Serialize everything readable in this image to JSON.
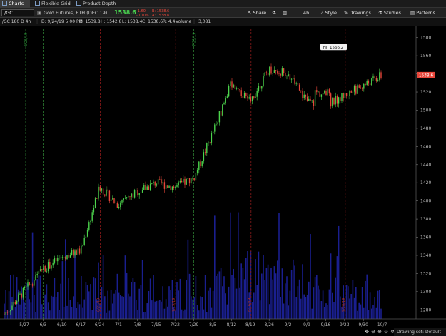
{
  "tabs": [
    {
      "label": "Charts",
      "active": true,
      "icon": "chart-icon"
    },
    {
      "label": "Flexible Grid",
      "active": false,
      "icon": "grid-icon"
    },
    {
      "label": "Product Depth",
      "active": false,
      "icon": "depth-icon"
    }
  ],
  "toolbar": {
    "symbol": "/GC",
    "description": "Gold Futures, ETH (DEC 19)",
    "last": "1538.6",
    "change": "-1.60",
    "change_pct": "-0.10%",
    "bid": "B: 1538.6",
    "ask": "A: 1538.8",
    "buttons": [
      "Share",
      "4h",
      "Style",
      "Drawings",
      "Studies",
      "Patterns"
    ]
  },
  "info": {
    "study_label": "/GC 180 D 4h",
    "date": "D: 9/24/19 5:00 PM",
    "open": "O: 1539.8",
    "high": "H: 1542.8",
    "low": "L: 1538.4",
    "close": "C: 1538.6",
    "range": "R: 4.4",
    "volume_label": "Volume",
    "volume": "3,081"
  },
  "chart_data": {
    "type": "candlestick",
    "x_ticks": [
      "5/27",
      "6/3",
      "6/10",
      "6/17",
      "6/24",
      "7/1",
      "7/8",
      "7/15",
      "7/22",
      "7/29",
      "8/5",
      "8/12",
      "8/19",
      "8/26",
      "9/2",
      "9/9",
      "9/16",
      "9/23",
      "9/30",
      "10/7"
    ],
    "y_ticks": [
      1280,
      1300,
      1320,
      1340,
      1360,
      1380,
      1400,
      1420,
      1440,
      1460,
      1480,
      1500,
      1520,
      1540,
      1560,
      1580
    ],
    "ylim": [
      1270,
      1590
    ],
    "close_path": [
      [
        "5/27",
        1275
      ],
      [
        "6/3",
        1325
      ],
      [
        "6/10",
        1338
      ],
      [
        "6/17",
        1345
      ],
      [
        "6/24",
        1415
      ],
      [
        "7/1",
        1395
      ],
      [
        "7/8",
        1410
      ],
      [
        "7/15",
        1420
      ],
      [
        "7/22",
        1415
      ],
      [
        "7/29",
        1425
      ],
      [
        "8/5",
        1475
      ],
      [
        "8/12",
        1530
      ],
      [
        "8/19",
        1510
      ],
      [
        "8/26",
        1545
      ],
      [
        "9/2",
        1540
      ],
      [
        "9/9",
        1510
      ],
      [
        "9/16",
        1505
      ],
      [
        "9/23",
        1538.6
      ]
    ],
    "hi_label": "Hi: 1566.2",
    "last_price_label": "1538.6",
    "green_markers": [
      "5/27",
      "6/3",
      "7/29"
    ],
    "green_marker_labels": [
      "5/28/19",
      "",
      "7/29/19"
    ],
    "red_markers": [
      "6/24",
      "7/22",
      "8/19",
      "9/23"
    ],
    "red_marker_labels": [
      "6/21/19",
      "7/19/19",
      "8/16/19",
      "9/20/19"
    ],
    "colors": {
      "up": "#4cd44c",
      "down": "#e8463a",
      "volume": "#1a1f8f",
      "marker_green": "#2e7d32",
      "marker_red": "#8b1a1a"
    }
  },
  "footer": {
    "drawing_set": "Drawing set: Default"
  }
}
